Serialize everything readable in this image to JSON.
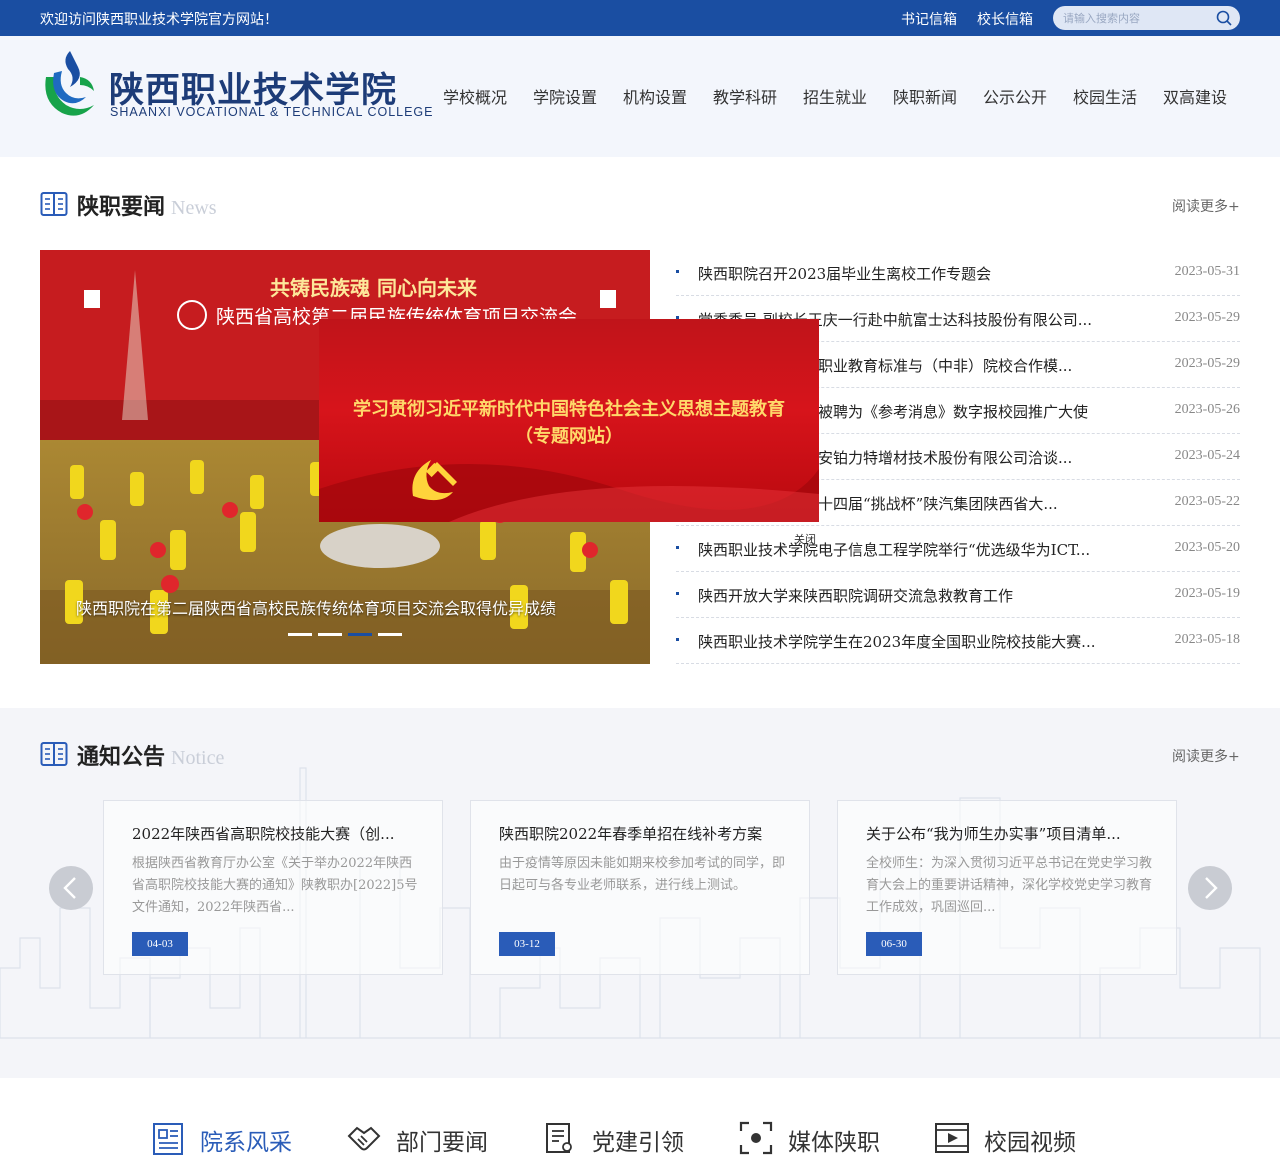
{
  "topbar": {
    "welcome": "欢迎访问陕西职业技术学院官方网站！",
    "mailbox_secretary": "书记信箱",
    "mailbox_president": "校长信箱",
    "search_placeholder": "请输入搜索内容"
  },
  "header": {
    "school_name_cn": "陕西职业技术学院",
    "school_name_en": "SHAANXI VOCATIONAL & TECHNICAL COLLEGE",
    "nav": [
      "学校概况",
      "学院设置",
      "机构设置",
      "教学科研",
      "招生就业",
      "陕职新闻",
      "公示公开",
      "校园生活",
      "双高建设"
    ]
  },
  "news_section": {
    "title": "陕职要闻",
    "title_en": "News",
    "more": "阅读更多+",
    "slider": {
      "banner_line1": "共铸民族魂 同心向未来",
      "banner_line2": "陕西省高校第二届民族传统体育项目交流会",
      "caption": "陕西职院在第二届陕西省高校民族传统体育项目交流会取得优异成绩",
      "slide_count": 4,
      "active_slide": 3
    },
    "items": [
      {
        "title": "陕西职院召开2023届毕业生离校工作专题会",
        "date": "2023-05-31"
      },
      {
        "title": "党委委员 副校长王庆一行赴中航富士达科技股份有限公司...",
        "date": "2023-05-29"
      },
      {
        "title": "陕西职院召开国际职业教育标准与（中非）院校合作模...",
        "date": "2023-05-29"
      },
      {
        "title": "陕西职业技术学院被聘为《参考消息》数字报校园推广大使",
        "date": "2023-05-26"
      },
      {
        "title": "校领导带队赴陕西安铂力特增材技术股份有限公司洽谈...",
        "date": "2023-05-24"
      },
      {
        "title": "陕西职院学子在第十四届“挑战杯”陕汽集团陕西省大...",
        "date": "2023-05-22"
      },
      {
        "title": "陕西职业技术学院电子信息工程学院举行“优选级华为ICT...",
        "date": "2023-05-20"
      },
      {
        "title": "陕西开放大学来陕西职院调研交流急救教育工作",
        "date": "2023-05-19"
      },
      {
        "title": "陕西职业技术学院学生在2023年度全国职业院校技能大赛...",
        "date": "2023-05-18"
      }
    ]
  },
  "popup": {
    "line1": "学习贯彻习近平新时代中国特色社会主义思想主题教育",
    "line2": "（专题网站）",
    "close": "关闭"
  },
  "notice_section": {
    "title": "通知公告",
    "title_en": "Notice",
    "more": "阅读更多+",
    "cards": [
      {
        "title": "2022年陕西省高职院校技能大赛（创...",
        "desc": "根据陕西省教育厅办公室《关于举办2022年陕西省高职院校技能大赛的通知》陕教职办[2022]5号文件通知，2022年陕西省...",
        "date": "04-03"
      },
      {
        "title": "陕西职院2022年春季单招在线补考方案",
        "desc": "由于疫情等原因未能如期来校参加考试的同学，即日起可与各专业老师联系，进行线上测试。",
        "date": "03-12"
      },
      {
        "title": "关于公布“我为师生办实事”项目清单...",
        "desc": "全校师生：为深入贯彻习近平总书记在党史学习教育大会上的重要讲话精神，深化学校党史学习教育工作成效，巩固巡回...",
        "date": "06-30"
      }
    ]
  },
  "bottom_tabs": [
    "院系风采",
    "部门要闻",
    "党建引领",
    "媒体陕职",
    "校园视频"
  ],
  "colors": {
    "primary": "#1a4ea2",
    "accent_date": "#2a5cb8",
    "popup_red": "#d7141b",
    "popup_text": "#ffd86a"
  }
}
